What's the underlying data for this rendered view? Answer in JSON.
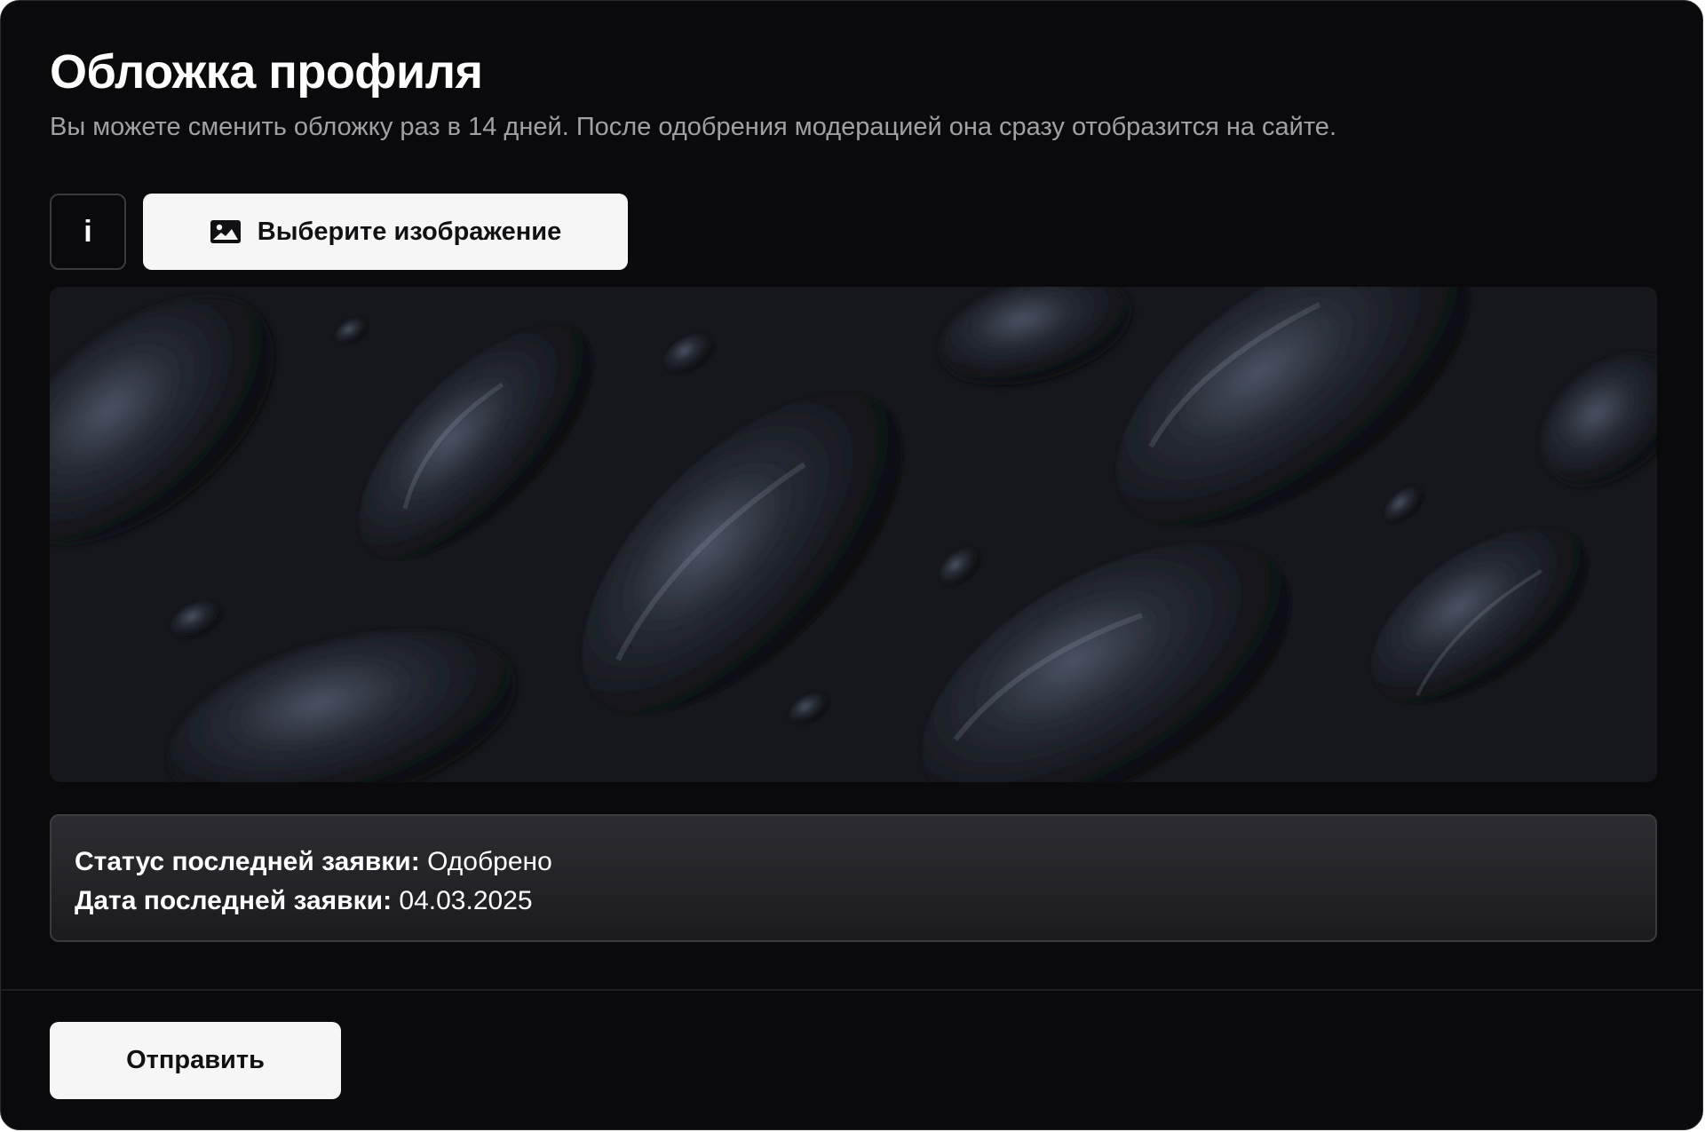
{
  "header": {
    "title": "Обложка профиля",
    "subtitle": "Вы можете сменить обложку раз в 14 дней. После одобрения модерацией она сразу отобразится на сайте."
  },
  "toolbar": {
    "info_label": "i",
    "choose_label": "Выберите изображение",
    "choose_icon": "image-icon"
  },
  "cover": {
    "icon": "cover-image"
  },
  "status": {
    "status_label": "Статус последней заявки:",
    "status_value": "Одобрено",
    "date_label": "Дата последней заявки:",
    "date_value": "04.03.2025"
  },
  "footer": {
    "submit_label": "Отправить"
  },
  "colors": {
    "background": "#0a0a0c",
    "button_bg": "#f6f6f6",
    "text": "#ffffff",
    "muted_text": "#a0a0a6"
  }
}
